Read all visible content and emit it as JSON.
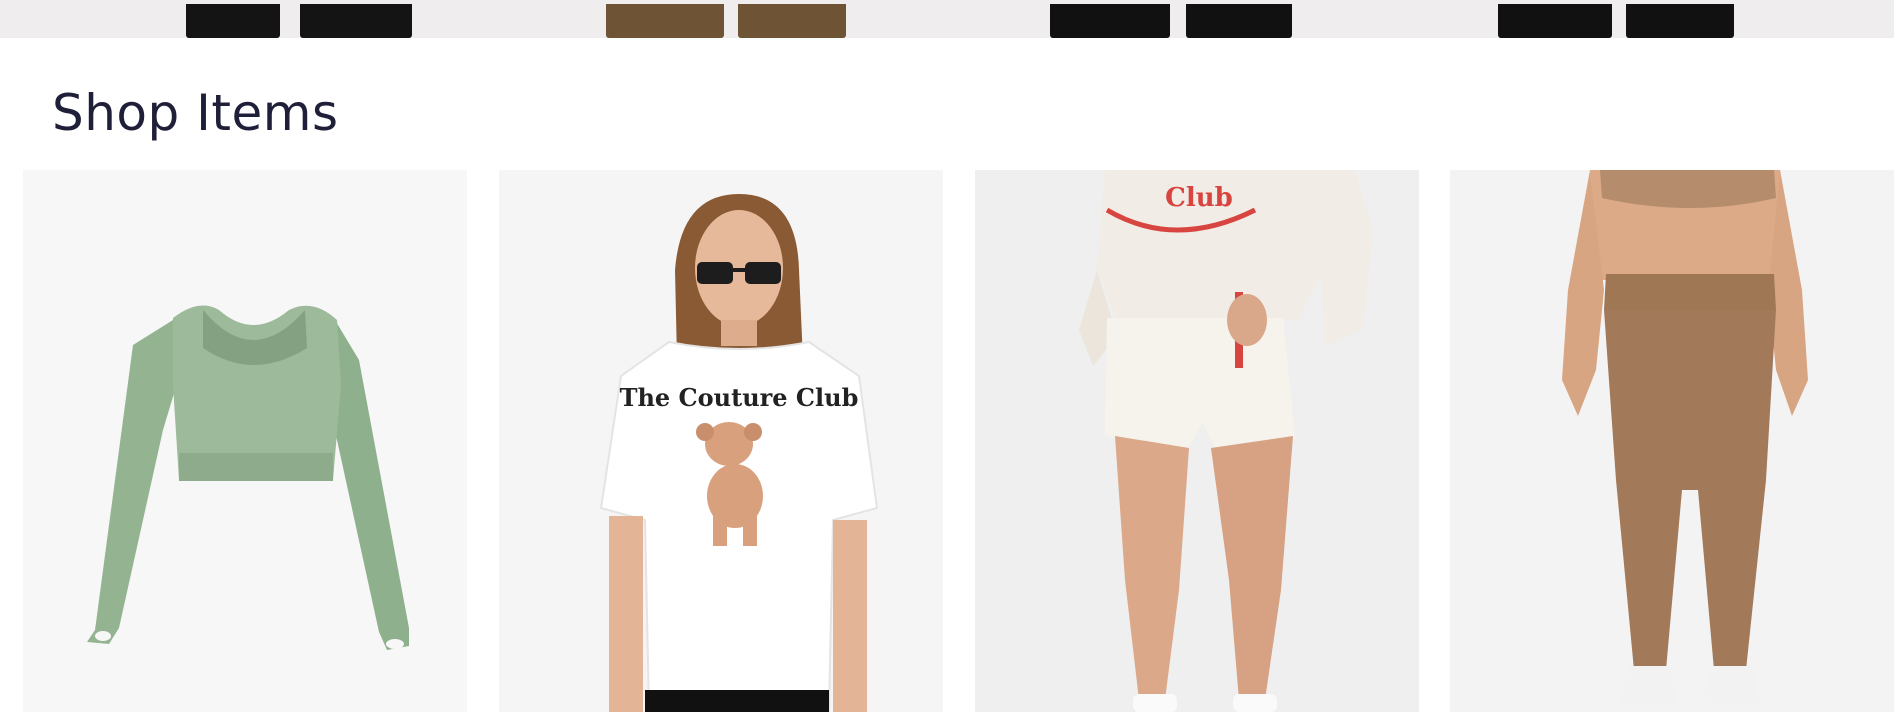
{
  "page": {
    "section_title": "Shop Items"
  },
  "top_strip": {
    "background": "#f0edee",
    "photos": [
      {
        "icon": "black-pants-legs-image"
      },
      {
        "icon": "brown-pants-legs-image"
      },
      {
        "icon": "black-pants-legs-image"
      },
      {
        "icon": "black-pants-legs-image"
      }
    ]
  },
  "products": [
    {
      "icon": "green-long-sleeve-crop-top-image",
      "color": "#9dba9a"
    },
    {
      "icon": "white-couture-club-tee-image",
      "color": "#ffffff",
      "print_text": "The Couture Club"
    },
    {
      "icon": "cream-sweat-shorts-set-image",
      "color": "#f1ede6",
      "print_text": "Club"
    },
    {
      "icon": "brown-seamless-leggings-image",
      "color": "#a27a5a"
    }
  ]
}
